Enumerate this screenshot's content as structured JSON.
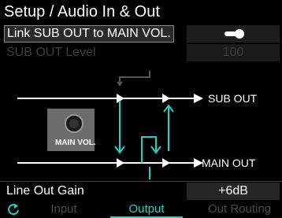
{
  "header": {
    "title": "Setup / Audio In & Out"
  },
  "link_row": {
    "label": "Link SUB OUT to MAIN VOL.",
    "toggle_on": true
  },
  "sub_level_row": {
    "label": "SUB OUT Level",
    "value": "100",
    "enabled": false
  },
  "diagram": {
    "sub_out_label": "SUB OUT",
    "main_out_label": "MAIN OUT",
    "knob_label": "MAIN VOL.",
    "accent_color": "#1fd1c6"
  },
  "gain_row": {
    "label": "Line Out Gain",
    "value": "+6dB"
  },
  "tabs": [
    {
      "label": "Input",
      "active": false
    },
    {
      "label": "Output",
      "active": true
    },
    {
      "label": "Out Routing",
      "active": false
    }
  ],
  "footer": {
    "back_icon": "refresh-icon"
  }
}
